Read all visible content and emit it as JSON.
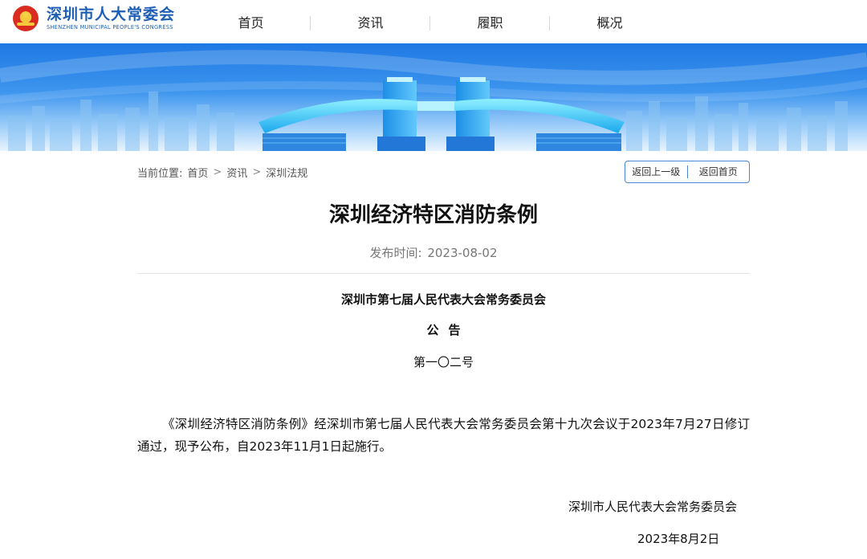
{
  "header": {
    "logo_cn": "深圳市人大常委会",
    "logo_en": "SHENZHEN MUNICIPAL PEOPLE'S CONGRESS",
    "nav": [
      "首页",
      "资讯",
      "履职",
      "概况"
    ]
  },
  "breadcrumb": {
    "prefix": "当前位置:",
    "items": [
      "首页",
      "资讯",
      "深圳法规"
    ],
    "separator": ">"
  },
  "actions": {
    "back": "返回上一级",
    "home": "返回首页"
  },
  "article": {
    "title": "深圳经济特区消防条例",
    "pubdate_label": "发布时间:",
    "pubdate": "2023-08-02",
    "issuer": "深圳市第七届人民代表大会常务委员会",
    "notice": "公告",
    "number": "第一〇二号",
    "body": "《深圳经济特区消防条例》经深圳市第七届人民代表大会常务委员会第十九次会议于2023年7月27日修订通过，现予公布，自2023年11月1日起施行。",
    "signature": "深圳市人民代表大会常务委员会",
    "sign_date": "2023年8月2日"
  },
  "colors": {
    "brand": "#1e5fb5",
    "button_border": "#4a86d6",
    "banner": "#1f79e3"
  }
}
